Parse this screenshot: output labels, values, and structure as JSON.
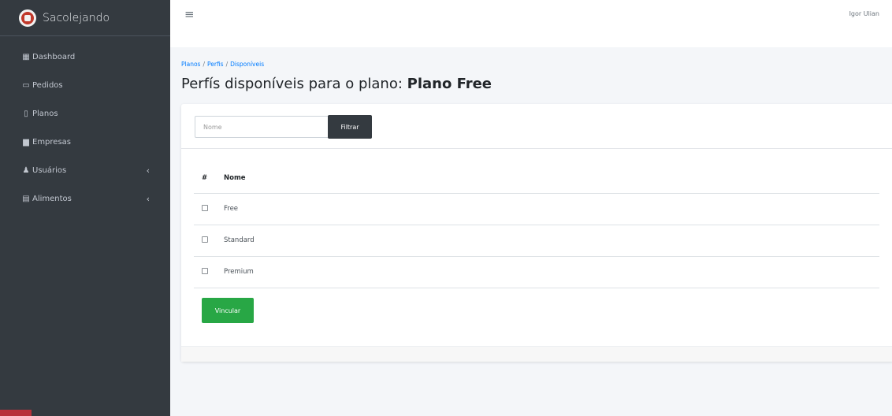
{
  "brand": {
    "name": "Sacolejando"
  },
  "sidebar": {
    "items": [
      {
        "label": "Dashboard",
        "icon": "table-icon",
        "glyph": "▦",
        "has_children": false
      },
      {
        "label": "Pedidos",
        "icon": "calendar-icon",
        "glyph": "▭",
        "has_children": false
      },
      {
        "label": "Planos",
        "icon": "clipboard-icon",
        "glyph": "▯",
        "has_children": false
      },
      {
        "label": "Empresas",
        "icon": "building-icon",
        "glyph": "▆",
        "has_children": false
      },
      {
        "label": "Usuários",
        "icon": "users-icon",
        "glyph": "♟",
        "has_children": true
      },
      {
        "label": "Alimentos",
        "icon": "database-icon",
        "glyph": "▤",
        "has_children": true
      }
    ],
    "chevron": "‹"
  },
  "navbar": {
    "menu_glyph": "≡",
    "user_name": "Igor Ulian"
  },
  "breadcrumb": {
    "items": [
      "Planos",
      "Perfis",
      "Disponíveis"
    ],
    "separator": "/"
  },
  "page": {
    "title_prefix": "Perfís disponíveis para o plano: ",
    "title_plan": "Plano Free"
  },
  "filter": {
    "placeholder": "Nome",
    "value": "",
    "button_label": "Filtrar"
  },
  "table": {
    "headers": [
      "#",
      "Nome"
    ],
    "rows": [
      {
        "name": "Free",
        "checked": false
      },
      {
        "name": "Standard",
        "checked": false
      },
      {
        "name": "Premium",
        "checked": false
      }
    ]
  },
  "actions": {
    "bind_label": "Vincular"
  },
  "colors": {
    "sidebar_bg": "#343a40",
    "primary_link": "#007bff",
    "success": "#28a745",
    "dark_button": "#343a40"
  }
}
